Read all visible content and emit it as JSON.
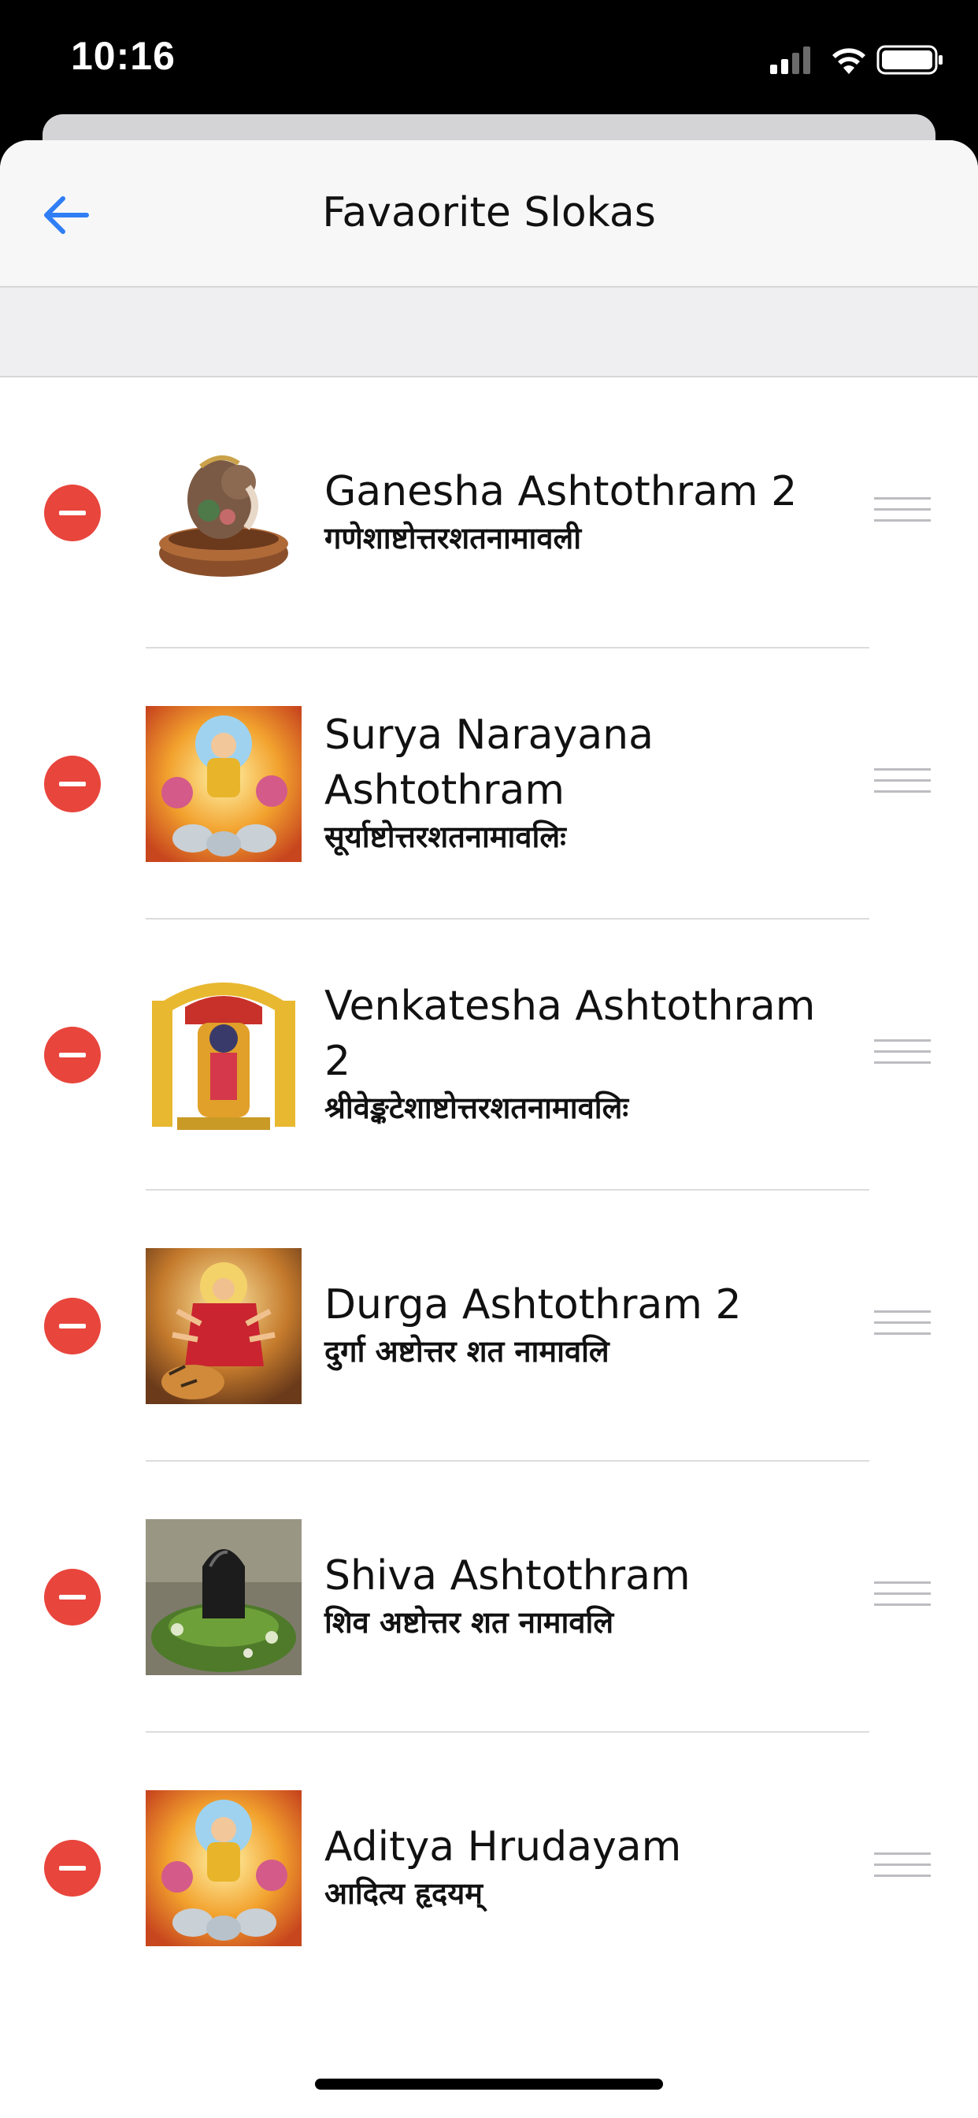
{
  "status_bar": {
    "time": "10:16",
    "icons": [
      "cellular-signal-icon",
      "wifi-icon",
      "battery-icon"
    ]
  },
  "nav": {
    "back_icon": "arrow-left-icon",
    "title": "Favaorite Slokas"
  },
  "colors": {
    "accent": "#2f7ef5",
    "delete": "#e8453c",
    "divider": "#dcdcde"
  },
  "favorites": [
    {
      "title": "Ganesha Ashtothram 2",
      "subtitle": "गणेशाष्टोत्तरशतनामावली",
      "image": "ganesha-image"
    },
    {
      "title": "Surya Narayana Ashtothram",
      "subtitle": "सूर्याष्टोत्तरशतनामावलिः",
      "image": "surya-image"
    },
    {
      "title": "Venkatesha Ashtothram 2",
      "subtitle": "श्रीवेङ्कटेशाष्टोत्तरशतनामावलिः",
      "image": "venkatesha-image"
    },
    {
      "title": "Durga Ashtothram 2",
      "subtitle": "दुर्गा अष्टोत्तर शत नामावलि",
      "image": "durga-image"
    },
    {
      "title": "Shiva Ashtothram",
      "subtitle": "शिव अष्टोत्तर शत नामावलि",
      "image": "shiva-lingam-image"
    },
    {
      "title": "Aditya Hrudayam",
      "subtitle": "आदित्य हृदयम्",
      "image": "aditya-image"
    }
  ]
}
